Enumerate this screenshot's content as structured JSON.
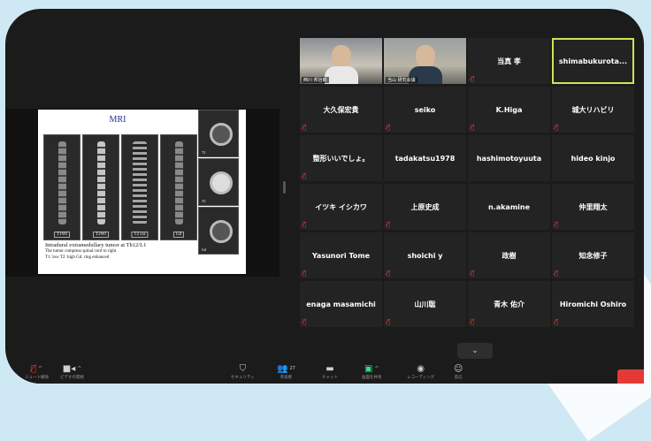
{
  "colors": {
    "active_speaker_border": "#d4e157",
    "muted_icon": "#e53935",
    "end_button": "#e53935",
    "share_icon": "#3ddc84"
  },
  "slide": {
    "title": "MRI",
    "scans": [
      "T1WI",
      "T2WI",
      "T2 cor",
      "Gd"
    ],
    "axial_labels": [
      "T1",
      "T2",
      "Gd"
    ],
    "caption_lines": [
      "Intradural extramedullary tumor at Th12/L1",
      "The tumor compress spinal cord to right",
      "T1: low     T2: high       Gd: ring enhanced"
    ]
  },
  "participants": [
    {
      "name": "",
      "video_label": "西川 邦治郎",
      "has_video": true,
      "muted": true
    },
    {
      "name": "",
      "video_label": "当山 研究会議",
      "has_video": true,
      "muted": true
    },
    {
      "name": "当真 孝",
      "muted": true
    },
    {
      "name": "shimabukurota...",
      "muted": false,
      "active": true
    },
    {
      "name": "大久保宏貴",
      "muted": true
    },
    {
      "name": "seiko",
      "muted": true
    },
    {
      "name": "K.Higa",
      "muted": true
    },
    {
      "name": "城大リハビリ",
      "muted": true
    },
    {
      "name": "整形いいでしょ。",
      "muted": true
    },
    {
      "name": "tadakatsu1978",
      "muted": false
    },
    {
      "name": "hashimotoyuuta",
      "muted": false
    },
    {
      "name": "hideo kinjo",
      "muted": false
    },
    {
      "name": "イツキ イシカワ",
      "muted": true
    },
    {
      "name": "上原史成",
      "muted": true
    },
    {
      "name": "n.akamine",
      "muted": false
    },
    {
      "name": "仲里翔太",
      "muted": true
    },
    {
      "name": "Yasunori Tome",
      "muted": true
    },
    {
      "name": "shoichi y",
      "muted": true
    },
    {
      "name": "政樹",
      "muted": true
    },
    {
      "name": "知念修子",
      "muted": true
    },
    {
      "name": "enaga masamichi",
      "muted": true
    },
    {
      "name": "山川聡",
      "muted": true
    },
    {
      "name": "青木 佑介",
      "muted": true
    },
    {
      "name": "Hiromichi Oshiro",
      "muted": true
    }
  ],
  "gallery_more": "⌄",
  "toolbar": {
    "mute_label": "ミュート解除",
    "video_label": "ビデオの開始",
    "security_label": "セキュリティ",
    "participants_label": "参加者",
    "participants_count": "27",
    "chat_label": "チャット",
    "share_label": "画面を共有",
    "record_label": "レコーディング",
    "reactions_label": "反応"
  }
}
